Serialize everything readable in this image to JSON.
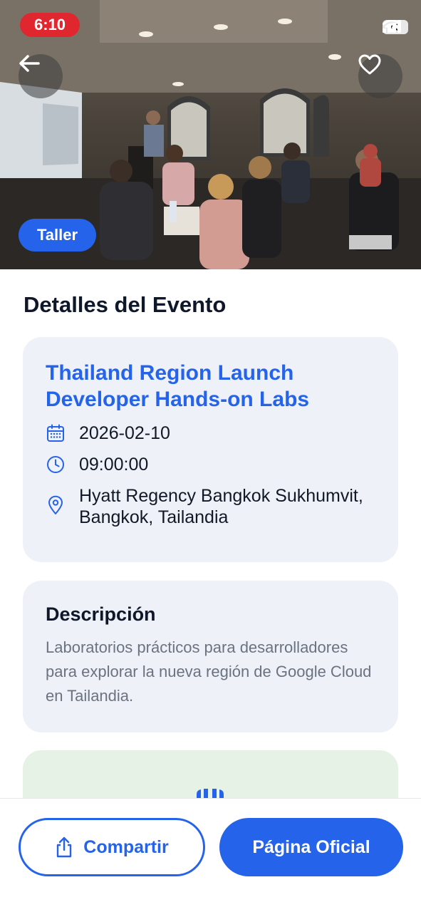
{
  "status_bar": {
    "time": "6:10",
    "battery": "43"
  },
  "hero": {
    "category_tag": "Taller"
  },
  "details": {
    "section_title": "Detalles del Evento"
  },
  "event": {
    "title": "Thailand Region Launch Developer Hands-on Labs",
    "date": "2026-02-10",
    "time": "09:00:00",
    "location": "Hyatt Regency Bangkok Sukhumvit, Bangkok, Tailandia"
  },
  "description": {
    "title": "Descripción",
    "text": "Laboratorios prácticos para desarrolladores para explorar la nueva región de Google Cloud en Tailandia."
  },
  "actions": {
    "share_label": "Compartir",
    "official_label": "Página Oficial"
  },
  "colors": {
    "accent": "#2563eb",
    "card_bg": "#eef2f8",
    "status_pill": "#e0262f"
  }
}
